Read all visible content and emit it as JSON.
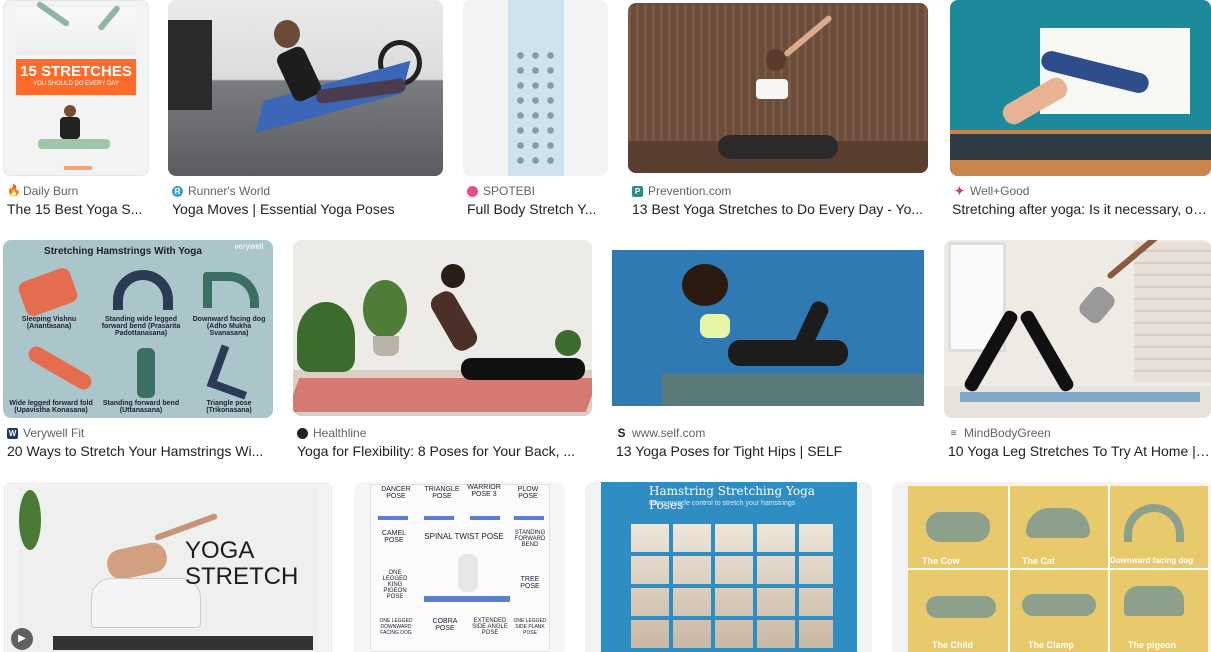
{
  "results": [
    {
      "source": "Daily Burn",
      "title": "The 15 Best Yoga S...",
      "favicon_color": "#f26522"
    },
    {
      "source": "Runner's World",
      "title": "Yoga Moves | Essential Yoga Poses",
      "favicon_color": "#3aa1c9"
    },
    {
      "source": "SPOTEBI",
      "title": "Full Body Stretch Y...",
      "favicon_color": "#e74c8b"
    },
    {
      "source": "Prevention.com",
      "title": "13 Best Yoga Stretches to Do Every Day - Yo...",
      "favicon_color": "#2e8b8b"
    },
    {
      "source": "Well+Good",
      "title": "Stretching after yoga: Is it necessary, or ...",
      "favicon_color": "#d63384"
    },
    {
      "source": "Verywell Fit",
      "title": "20 Ways to Stretch Your Hamstrings Wi...",
      "favicon_color": "#1e3a5f"
    },
    {
      "source": "Healthline",
      "title": "Yoga for Flexibility: 8 Poses for Your Back, ...",
      "favicon_color": "#202124"
    },
    {
      "source": "www.self.com",
      "title": "13 Yoga Poses for Tight Hips | SELF",
      "favicon_color": "#202124"
    },
    {
      "source": "MindBodyGreen",
      "title": "10 Yoga Leg Stretches To Try At Home | ...",
      "favicon_color": "#555555"
    }
  ],
  "thumb_text": {
    "dailyburn_headline": "15 STRETCHES",
    "dailyburn_sub": "YOU SHOULD DO EVERY DAY",
    "verywell_heading": "Stretching Hamstrings With Yoga",
    "verywell_brand": "verywell",
    "verywell_poses": [
      "Sleeping Vishnu (Anantasana)",
      "Standing wide legged forward bend (Prasarita Padottanasana)",
      "Downward facing dog (Adho Mukha Svanasana)",
      "Wide legged forward fold (Upavistha Konasana)",
      "Standing forward bend (Uttanasana)",
      "Triangle pose (Trikonasana)"
    ],
    "yoga_stretch": "YOGA\nSTRETCH",
    "spinal_heading": "SPINAL TWIST POSE",
    "spinal_poses": [
      "DANCER POSE",
      "TRIANGLE POSE",
      "WARRIOR POSE 3",
      "PLOW POSE",
      "CAMEL POSE",
      "STANDING FORWARD BEND",
      "TREE POSE",
      "ONE LEGGED KING PIGEON POSE",
      "COBRA POSE",
      "EXTENDED SIDE ANGLE POSE",
      "ONE LEGGED DOWNWARD FACING DOG",
      "ONE LEGGED SIDE PLANK POSE"
    ],
    "hamstring_heading": "Hamstring Stretching Yoga Poses",
    "hamstring_sub": "using muscle control to stretch your hamstrings",
    "cat_labels": [
      "The Cow",
      "The Cat",
      "Downward facing dog",
      "The Child",
      "The Clamp",
      "The pigeon"
    ]
  },
  "play_icon": "play-icon"
}
